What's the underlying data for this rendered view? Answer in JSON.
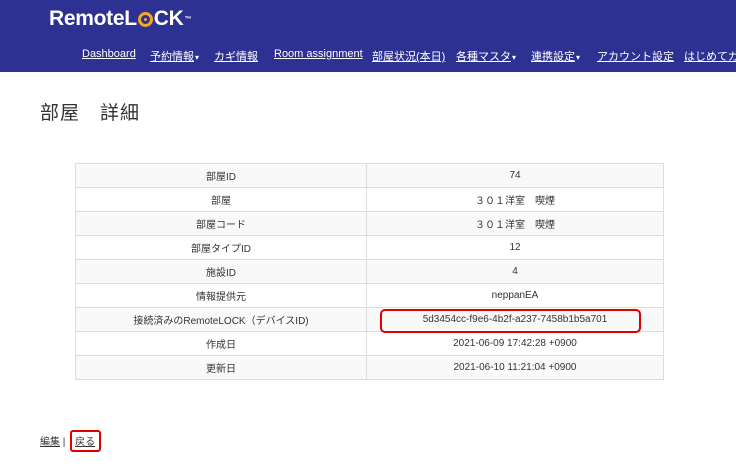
{
  "header": {
    "logo_text_a": "Remote",
    "logo_text_b": "L",
    "logo_text_c": "CK",
    "logo_tm": "™"
  },
  "nav": {
    "items": [
      {
        "label": "Dashboard",
        "caret": ""
      },
      {
        "label": "予約情報",
        "caret": "▾"
      },
      {
        "label": "カギ情報",
        "caret": ""
      },
      {
        "label": "Room assignment",
        "caret": ""
      },
      {
        "label": "部屋状況(本日)",
        "caret": ""
      },
      {
        "label": "各種マスタ",
        "caret": "▾"
      },
      {
        "label": "連携設定",
        "caret": "▾"
      },
      {
        "label": "アカウント設定",
        "caret": ""
      },
      {
        "label": "はじめてガー",
        "caret": ""
      }
    ]
  },
  "page": {
    "title": "部屋　詳細"
  },
  "detail": {
    "rows": [
      {
        "key": "部屋ID",
        "value": "74"
      },
      {
        "key": "部屋",
        "value": "３０１洋室　喫煙"
      },
      {
        "key": "部屋コード",
        "value": "３０１洋室　喫煙"
      },
      {
        "key": "部屋タイプID",
        "value": "12"
      },
      {
        "key": "施設ID",
        "value": "4"
      },
      {
        "key": "情報提供元",
        "value": "neppanEA"
      },
      {
        "key": "接続済みのRemoteLOCK（デバイスID)",
        "value": "5d3454cc-f9e6-4b2f-a237-7458b1b5a701"
      },
      {
        "key": "作成日",
        "value": "2021-06-09 17:42:28 +0900"
      },
      {
        "key": "更新日",
        "value": "2021-06-10 11:21:04 +0900"
      }
    ]
  },
  "footer": {
    "edit_label": "編集",
    "separator": " | ",
    "back_label": "戻る"
  },
  "colors": {
    "header_bg": "#2d3192",
    "logo_accent": "#f5a623",
    "highlight": "#e00000"
  }
}
